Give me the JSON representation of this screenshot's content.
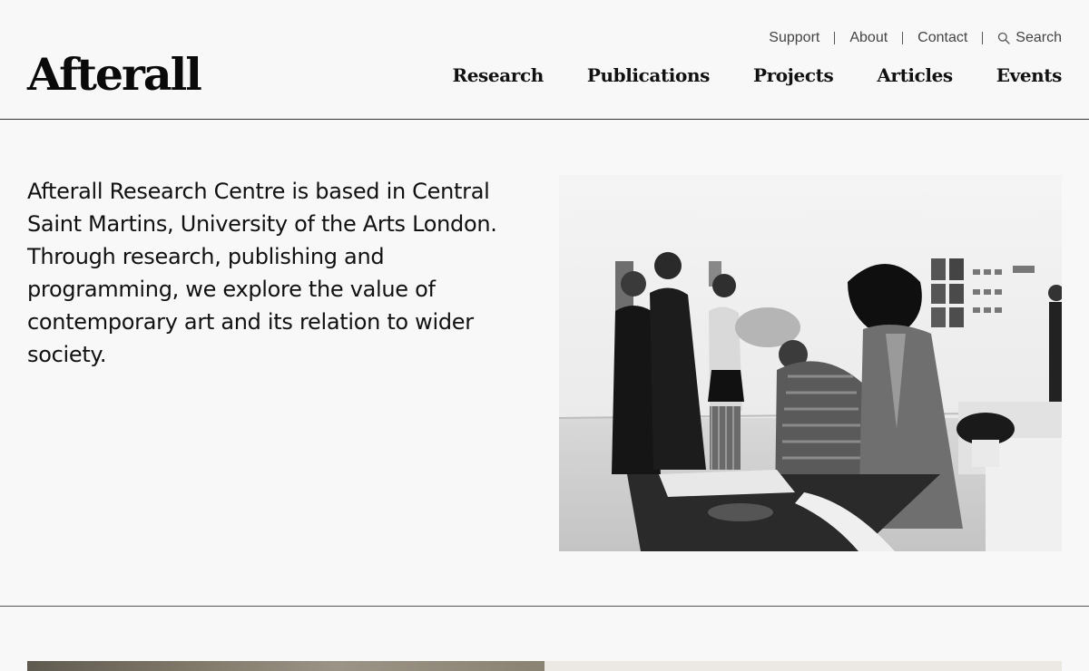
{
  "header": {
    "logo": "Afterall",
    "utility_nav": [
      "Support",
      "About",
      "Contact"
    ],
    "search_label": "Search",
    "main_nav": [
      "Research",
      "Publications",
      "Projects",
      "Articles",
      "Events"
    ]
  },
  "intro": {
    "text": "Afterall Research Centre is based in Central Saint Martins, University of the Arts London. Through research, publishing and programming, we explore the value of contemporary art and its relation to wider society."
  },
  "icons": {
    "search": "search-icon"
  }
}
